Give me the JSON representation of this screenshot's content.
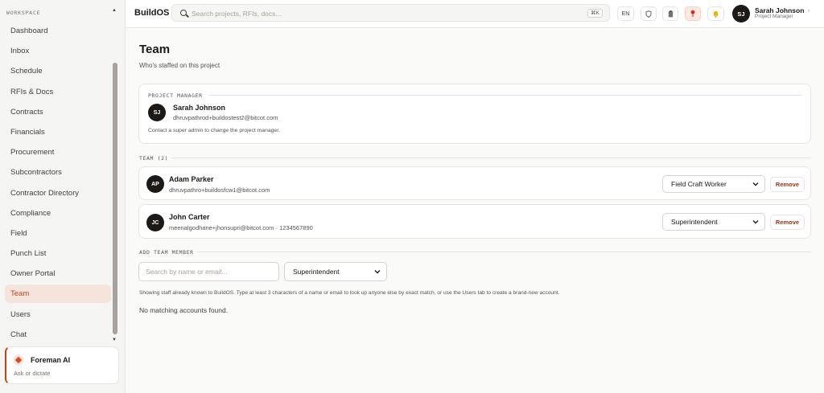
{
  "sidebar": {
    "section_label": "WORKSPACE",
    "items": [
      {
        "label": "Dashboard"
      },
      {
        "label": "Inbox"
      },
      {
        "label": "Schedule"
      },
      {
        "label": "RFIs & Docs"
      },
      {
        "label": "Contracts"
      },
      {
        "label": "Financials"
      },
      {
        "label": "Procurement"
      },
      {
        "label": "Subcontractors"
      },
      {
        "label": "Contractor Directory"
      },
      {
        "label": "Compliance"
      },
      {
        "label": "Field"
      },
      {
        "label": "Punch List"
      },
      {
        "label": "Owner Portal"
      },
      {
        "label": "Team",
        "active": true
      },
      {
        "label": "Users"
      },
      {
        "label": "Chat"
      }
    ],
    "foreman": {
      "title": "Foreman AI",
      "subtitle": "Ask or dictate"
    }
  },
  "topbar": {
    "brand": "BuildOS",
    "search_placeholder": "Search projects, RFIs, docs...",
    "search_shortcut": "⌘K",
    "language": "EN",
    "user": {
      "initials": "SJ",
      "name": "Sarah Johnson",
      "role": "Project Manager"
    }
  },
  "main": {
    "title": "Team",
    "subtitle": "Who's staffed on this project",
    "project_manager": {
      "section_label": "PROJECT MANAGER",
      "initials": "SJ",
      "name": "Sarah Johnson",
      "email": "dhruvpathrod+buildostest2@bitcot.com",
      "note": "Contact a super admin to change the project manager."
    },
    "team": {
      "section_label": "TEAM (2)",
      "members": [
        {
          "initials": "AP",
          "name": "Adam Parker",
          "details": "dhruvpathro+buildosfcw1@bitcot.com",
          "role": "Field Craft Worker",
          "remove_label": "Remove"
        },
        {
          "initials": "JC",
          "name": "John Carter",
          "details": "meenalgodhane+jhonsupri@bitcot.com · 1234567890",
          "role": "Superintendent",
          "remove_label": "Remove"
        }
      ]
    },
    "add_member": {
      "section_label": "ADD TEAM MEMBER",
      "search_placeholder": "Search by name or email...",
      "role": "Superintendent",
      "help": "Showing staff already known to BuildOS. Type at least 3 characters of a name or email to look up anyone else by exact match, or use the Users tab to create a brand-new account.",
      "empty": "No matching accounts found."
    }
  }
}
